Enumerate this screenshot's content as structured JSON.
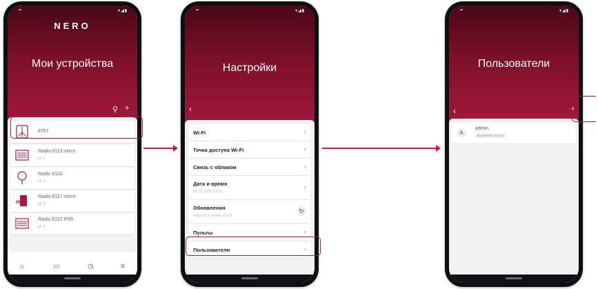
{
  "screen1": {
    "logo": "NERO",
    "title": "Мои устройства",
    "devices": [
      {
        "name": "8767",
        "id": ""
      },
      {
        "name": "Radio 8113 micro",
        "id": "id: 1"
      },
      {
        "name": "Radio 8122",
        "id": "id: 2"
      },
      {
        "name": "Radio 8117 micro",
        "id": "id: 3"
      },
      {
        "name": "Radio 8113 IP65",
        "id": "id: 4"
      }
    ],
    "icons": {
      "search": "search-icon",
      "add": "plus-icon",
      "home": "home-icon",
      "devices": "devices-icon",
      "history": "clock-icon",
      "menu": "menu-icon"
    }
  },
  "screen2": {
    "title": "Настройки",
    "rows": [
      {
        "label": "Wi-Fi",
        "sub": ""
      },
      {
        "label": "Точка доступа Wi-Fi",
        "sub": ""
      },
      {
        "label": "Связь с облаком",
        "sub": ""
      },
      {
        "label": "Дата и время",
        "sub": "01.01.2226 03:01"
      },
      {
        "label": "Обновления",
        "sub": "Hard v8.0, Radio v13.0"
      },
      {
        "label": "Пульты",
        "sub": ""
      },
      {
        "label": "Пользователи",
        "sub": ""
      }
    ]
  },
  "screen3": {
    "title": "Пользователи",
    "user": {
      "avatar": "A",
      "name": "admin",
      "role": "Администратор"
    }
  },
  "colors": {
    "brand": "#a3183a",
    "brand_dark": "#4a0718",
    "arrow": "#c01e45"
  }
}
